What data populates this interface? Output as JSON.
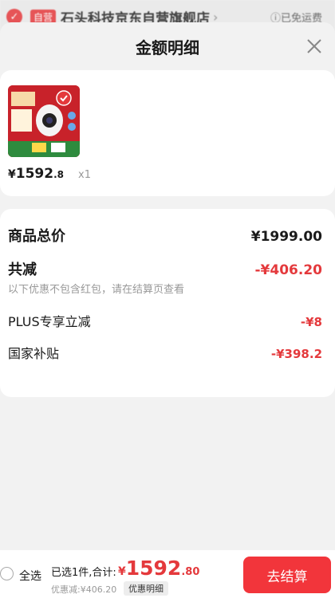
{
  "store": {
    "tag": "自营",
    "name": "石头科技京东自营旗舰店",
    "arrow": "›",
    "shipping": "ⓘ已免运费"
  },
  "sheet": {
    "title": "金额明细"
  },
  "product": {
    "price_symbol": "¥",
    "price_int": "1592",
    "price_dec": ".8",
    "quantity": "x1"
  },
  "detail": {
    "total_label": "商品总价",
    "total_value": "¥1999.00",
    "reduce_label": "共减",
    "reduce_value": "-¥406.20",
    "note": "以下优惠不包含红包，请在结算页查看",
    "plus_label": "PLUS专享立减",
    "plus_value": "-¥8",
    "subsidy_label": "国家补贴",
    "subsidy_value": "-¥398.2"
  },
  "bottom": {
    "select_all": "全选",
    "summary": "已选1件,合计:",
    "total_symbol": "¥",
    "total_int": "1592",
    "total_dec": ".80",
    "discount": "优惠减:¥406.20",
    "detail_link": "优惠明细",
    "checkout": "去结算"
  },
  "colors": {
    "accent": "#e4393c",
    "checkout": "#f2353b"
  }
}
